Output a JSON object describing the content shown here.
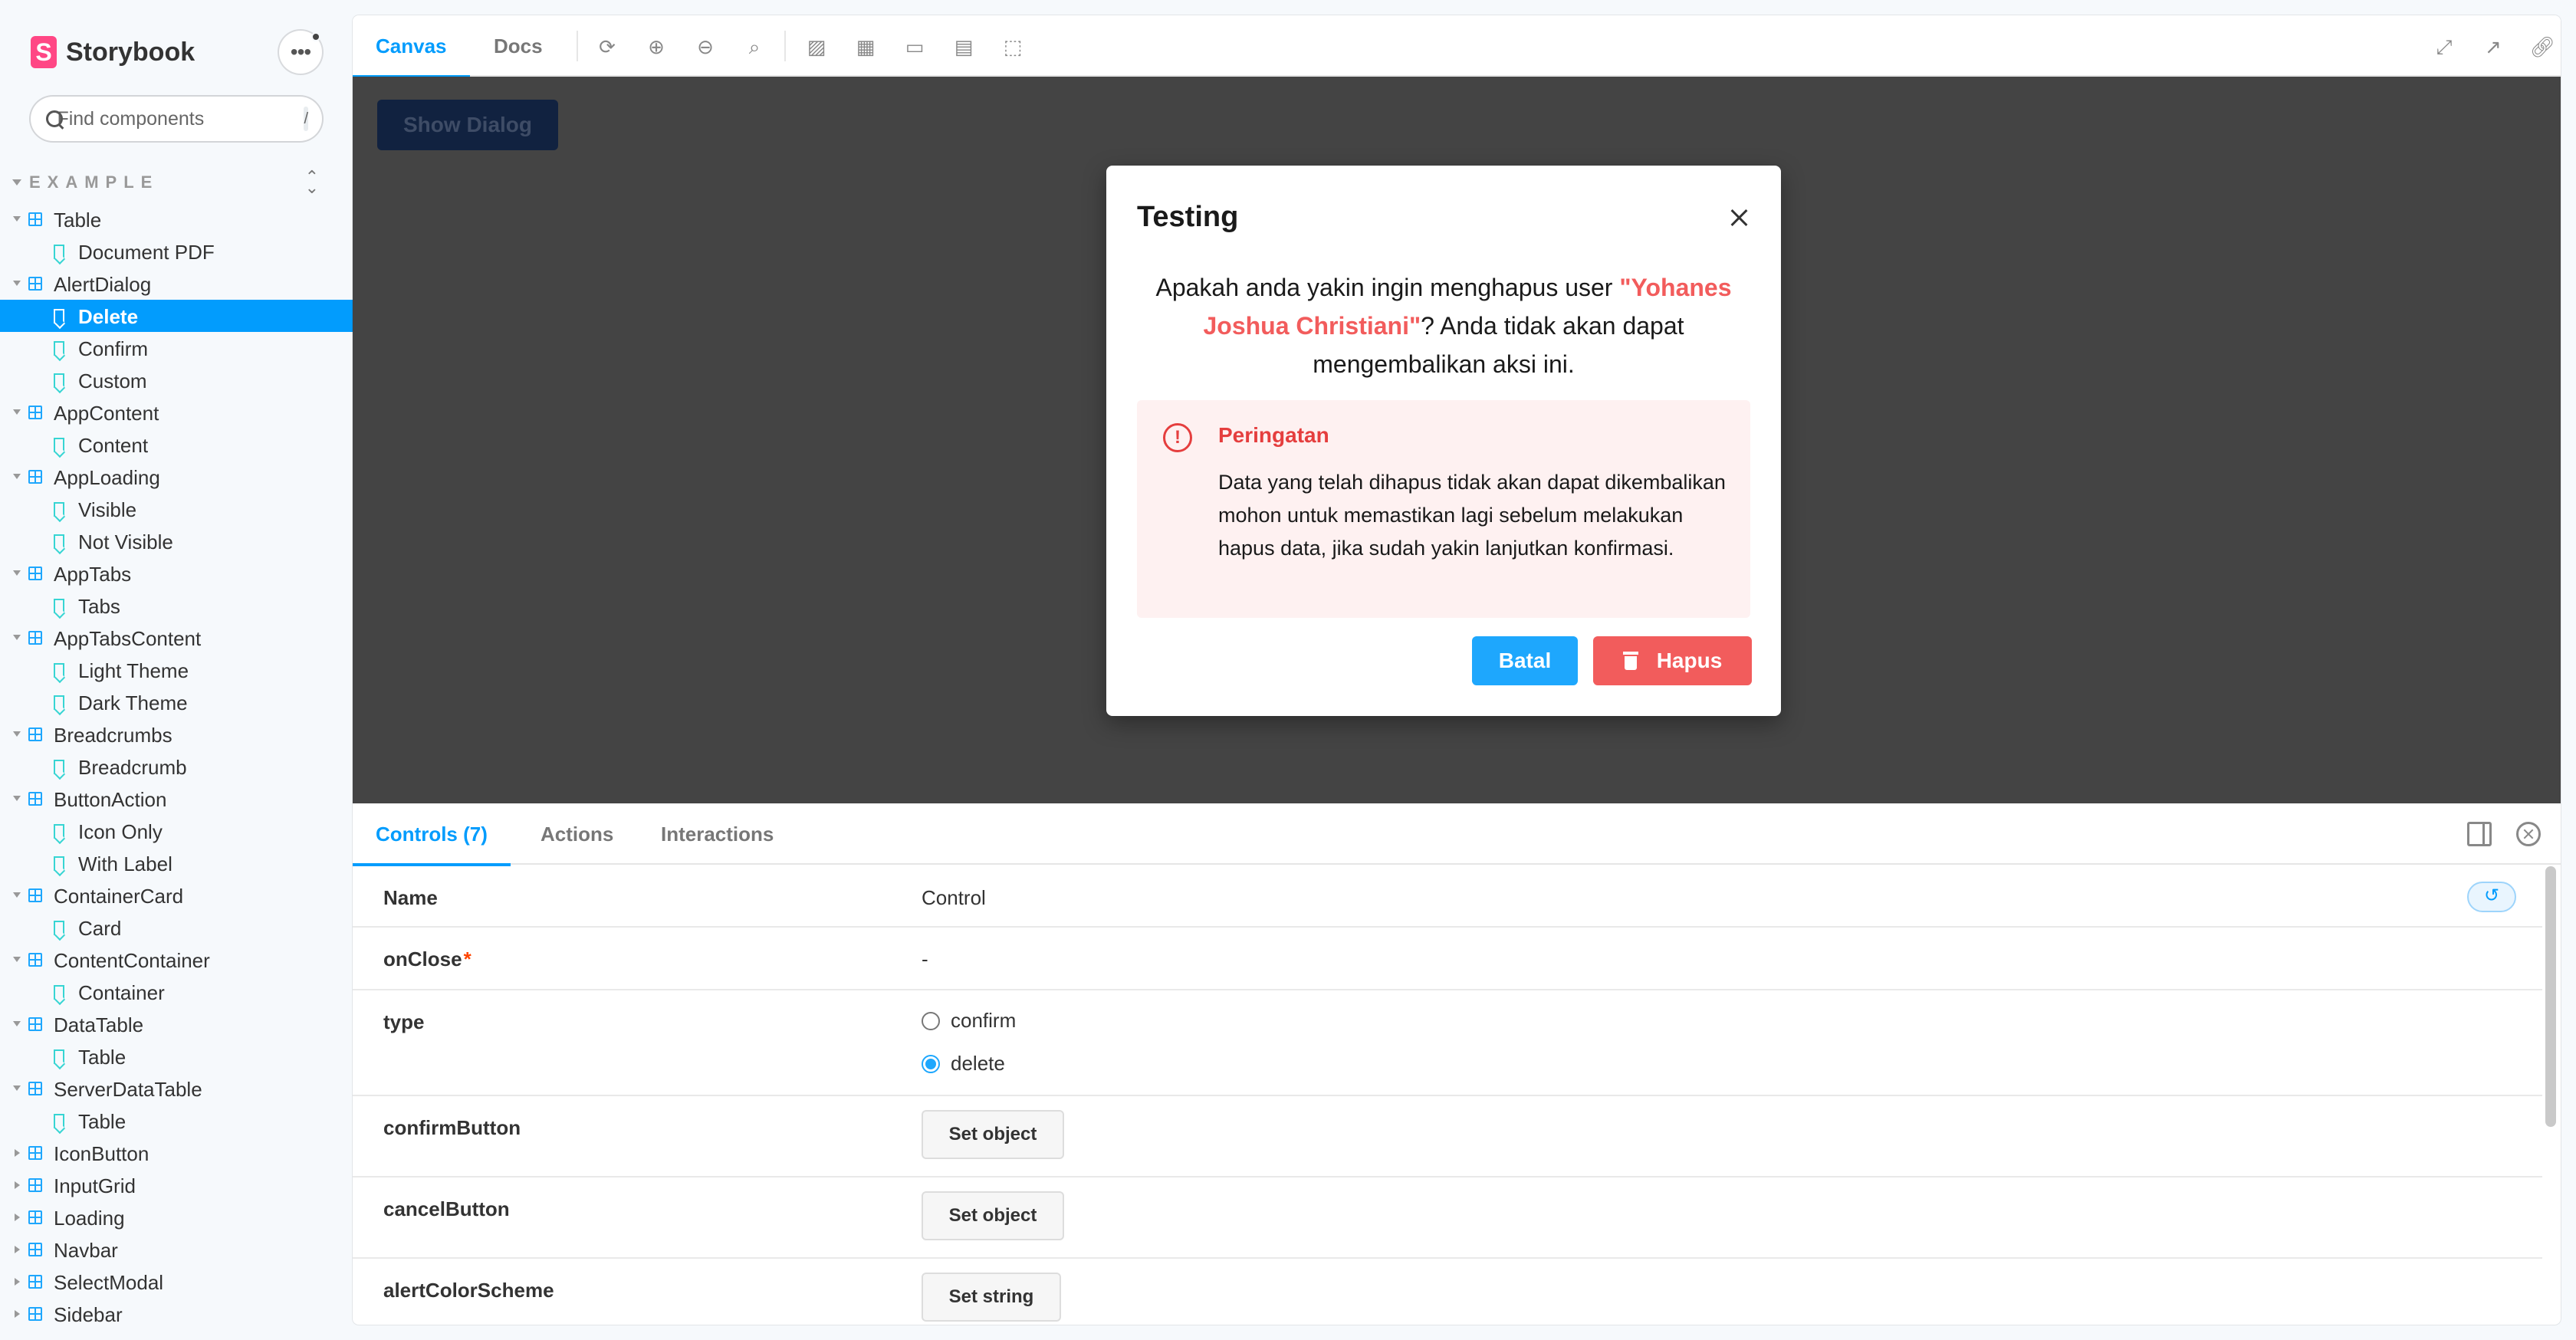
{
  "brand": {
    "name": "Storybook",
    "logo_letter": "S"
  },
  "search": {
    "placeholder": "Find components",
    "shortcut": "/"
  },
  "section": {
    "label": "EXAMPLE"
  },
  "tree": [
    {
      "type": "component",
      "label": "Table",
      "expanded": true
    },
    {
      "type": "story",
      "label": "Document PDF"
    },
    {
      "type": "component",
      "label": "AlertDialog",
      "expanded": true
    },
    {
      "type": "story",
      "label": "Delete",
      "selected": true
    },
    {
      "type": "story",
      "label": "Confirm"
    },
    {
      "type": "story",
      "label": "Custom"
    },
    {
      "type": "component",
      "label": "AppContent",
      "expanded": true
    },
    {
      "type": "story",
      "label": "Content"
    },
    {
      "type": "component",
      "label": "AppLoading",
      "expanded": true
    },
    {
      "type": "story",
      "label": "Visible"
    },
    {
      "type": "story",
      "label": "Not Visible"
    },
    {
      "type": "component",
      "label": "AppTabs",
      "expanded": true
    },
    {
      "type": "story",
      "label": "Tabs"
    },
    {
      "type": "component",
      "label": "AppTabsContent",
      "expanded": true
    },
    {
      "type": "story",
      "label": "Light Theme"
    },
    {
      "type": "story",
      "label": "Dark Theme"
    },
    {
      "type": "component",
      "label": "Breadcrumbs",
      "expanded": true
    },
    {
      "type": "story",
      "label": "Breadcrumb"
    },
    {
      "type": "component",
      "label": "ButtonAction",
      "expanded": true
    },
    {
      "type": "story",
      "label": "Icon Only"
    },
    {
      "type": "story",
      "label": "With Label"
    },
    {
      "type": "component",
      "label": "ContainerCard",
      "expanded": true
    },
    {
      "type": "story",
      "label": "Card"
    },
    {
      "type": "component",
      "label": "ContentContainer",
      "expanded": true
    },
    {
      "type": "story",
      "label": "Container"
    },
    {
      "type": "component",
      "label": "DataTable",
      "expanded": true
    },
    {
      "type": "story",
      "label": "Table"
    },
    {
      "type": "component",
      "label": "ServerDataTable",
      "expanded": true
    },
    {
      "type": "story",
      "label": "Table"
    },
    {
      "type": "component",
      "label": "IconButton",
      "expanded": false
    },
    {
      "type": "component",
      "label": "InputGrid",
      "expanded": false
    },
    {
      "type": "component",
      "label": "Loading",
      "expanded": false
    },
    {
      "type": "component",
      "label": "Navbar",
      "expanded": false
    },
    {
      "type": "component",
      "label": "SelectModal",
      "expanded": false
    },
    {
      "type": "component",
      "label": "Sidebar",
      "expanded": false
    }
  ],
  "toolbar": {
    "tabs": [
      "Canvas",
      "Docs"
    ],
    "icons": [
      "reload-icon",
      "zoom-in-icon",
      "zoom-out-icon",
      "zoom-reset-icon",
      "background-icon",
      "grid-icon",
      "viewport-icon",
      "measure-icon",
      "outline-icon",
      "fullscreen-icon",
      "open-new-tab-icon",
      "copy-link-icon"
    ]
  },
  "canvas": {
    "show_dialog_label": "Show Dialog",
    "dialog": {
      "title": "Testing",
      "message_prefix": "Apakah anda yakin ingin menghapus user ",
      "message_highlight": "\"Yohanes Joshua Christiani\"",
      "message_suffix": "? Anda tidak akan dapat mengembalikan aksi ini.",
      "warning_title": "Peringatan",
      "warning_text": "Data yang telah dihapus tidak akan dapat dikembalikan mohon untuk memastikan lagi sebelum melakukan hapus data, jika sudah yakin lanjutkan konfirmasi.",
      "cancel_label": "Batal",
      "delete_label": "Hapus"
    }
  },
  "panel": {
    "tabs": [
      "Controls (7)",
      "Actions",
      "Interactions"
    ],
    "header": {
      "name": "Name",
      "control": "Control"
    },
    "rows": {
      "onClose": {
        "name": "onClose",
        "required": "*",
        "value": "-"
      },
      "type": {
        "name": "type",
        "options": [
          "confirm",
          "delete"
        ],
        "selected": "delete"
      },
      "confirmButton": {
        "name": "confirmButton",
        "button": "Set object"
      },
      "cancelButton": {
        "name": "cancelButton",
        "button": "Set object"
      },
      "alertColorScheme": {
        "name": "alertColorScheme",
        "button": "Set string"
      }
    }
  },
  "colors": {
    "accent": "#029cfd",
    "danger": "#f25c5c",
    "canvas_bg": "#444444",
    "brand": "#ff4785"
  }
}
